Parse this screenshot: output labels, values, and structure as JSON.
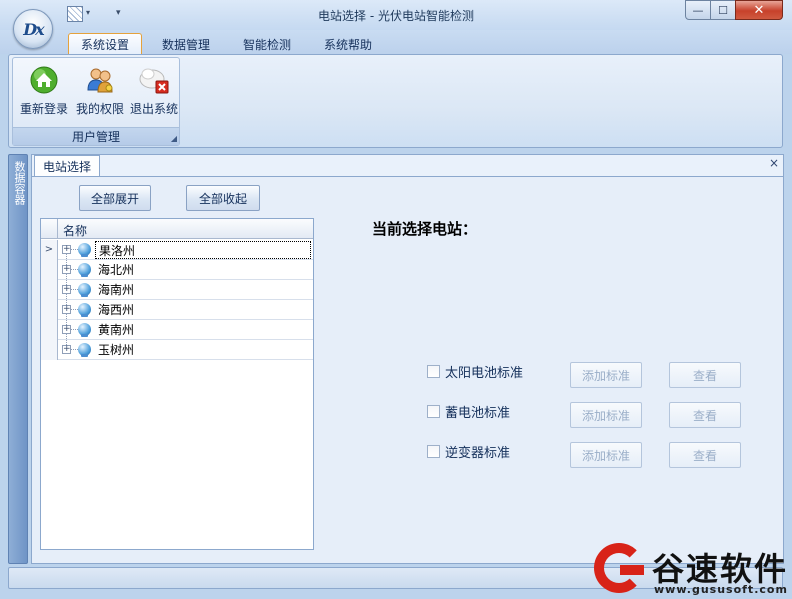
{
  "app": {
    "title": "电站选择 - 光伏电站智能检测",
    "logo_text": "Dx",
    "window_close": "✕",
    "window_max": "☐",
    "window_min": "—"
  },
  "ribbon": {
    "tabs": [
      {
        "label": "系统设置",
        "active": true
      },
      {
        "label": "数据管理",
        "active": false
      },
      {
        "label": "智能检测",
        "active": false
      },
      {
        "label": "系统帮助",
        "active": false
      }
    ],
    "group": {
      "label": "用户管理",
      "buttons": [
        {
          "label": "重新登录",
          "icon": "home-icon"
        },
        {
          "label": "我的权限",
          "icon": "users-icon"
        },
        {
          "label": "退出系统",
          "icon": "exit-icon"
        }
      ]
    }
  },
  "side_panel": {
    "label": "数据容器"
  },
  "document_tab": {
    "label": "电站选择",
    "close": "×"
  },
  "toolbar": {
    "expand_all": "全部展开",
    "collapse_all": "全部收起"
  },
  "tree": {
    "column_header": "名称",
    "rows": [
      "果洛州",
      "海北州",
      "海南州",
      "海西州",
      "黄南州",
      "玉树州"
    ],
    "current_marker": ">",
    "expand_glyph": "+"
  },
  "selection": {
    "label": "当前选择电站："
  },
  "standards": [
    {
      "label": "太阳电池标准",
      "checked": false,
      "add_label": "添加标准",
      "view_label": "查看"
    },
    {
      "label": "蓄电池标准",
      "checked": false,
      "add_label": "添加标准",
      "view_label": "查看"
    },
    {
      "label": "逆变器标准",
      "checked": false,
      "add_label": "添加标准",
      "view_label": "查看"
    }
  ],
  "watermark": {
    "brand": "谷速软件",
    "url": "www.gususoft.com"
  },
  "colors": {
    "accent": "#e5a23c",
    "brand_red": "#d82318",
    "ribbon_blue": "#bcd3ec"
  }
}
